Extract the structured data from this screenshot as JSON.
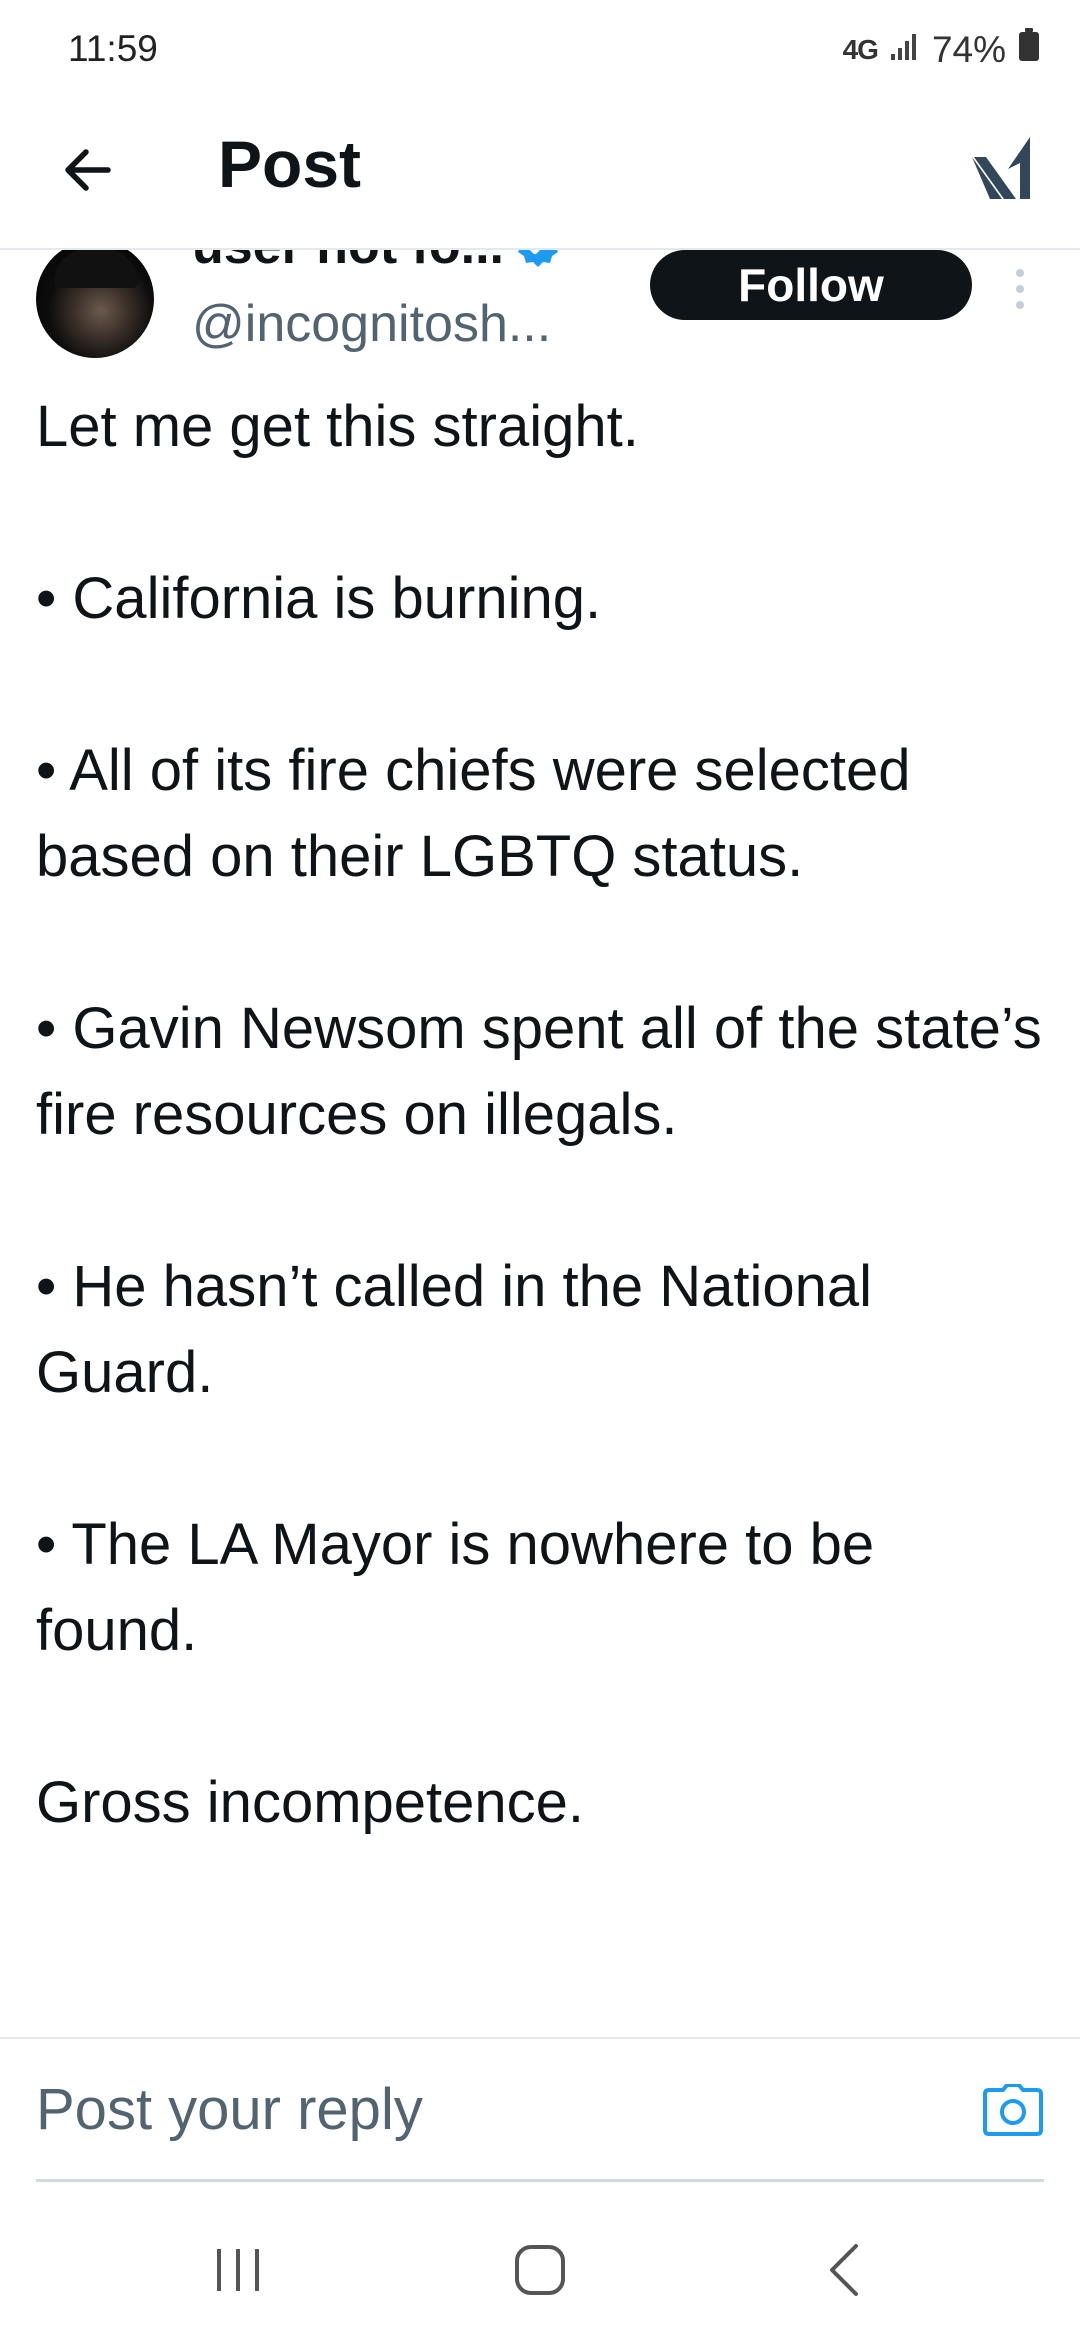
{
  "status_bar": {
    "time": "11:59",
    "network": "4G",
    "battery": "74%"
  },
  "header": {
    "title": "Post",
    "back_icon": "arrow-left-icon",
    "grok_icon": "grok-icon"
  },
  "post": {
    "author_name": "user not fo...",
    "verified_icon": "verified-badge-icon",
    "author_handle": "@incognitosh...",
    "follow_label": "Follow",
    "more_icon": "more-vertical-icon",
    "paragraphs": [
      "Let me get this straight.",
      "• California is burning.",
      "• All of its fire chiefs were selected based on their LGBTQ status.",
      "• Gavin Newsom spent all of the state’s fire resources on illegals.",
      "• He hasn’t called in the National Guard.",
      "• The LA Mayor is nowhere to be found.",
      "Gross incompetence."
    ]
  },
  "reply": {
    "placeholder": "Post your reply",
    "camera_icon": "camera-icon"
  },
  "colors": {
    "text": "#0f1419",
    "secondary_text": "#536471",
    "follow_bg": "#0f1419",
    "verified": "#1d9bf0",
    "camera": "#1d9bf0"
  },
  "nav": {
    "recents_icon": "recents-icon",
    "home_icon": "home-icon",
    "back_icon": "back-chevron-icon"
  }
}
